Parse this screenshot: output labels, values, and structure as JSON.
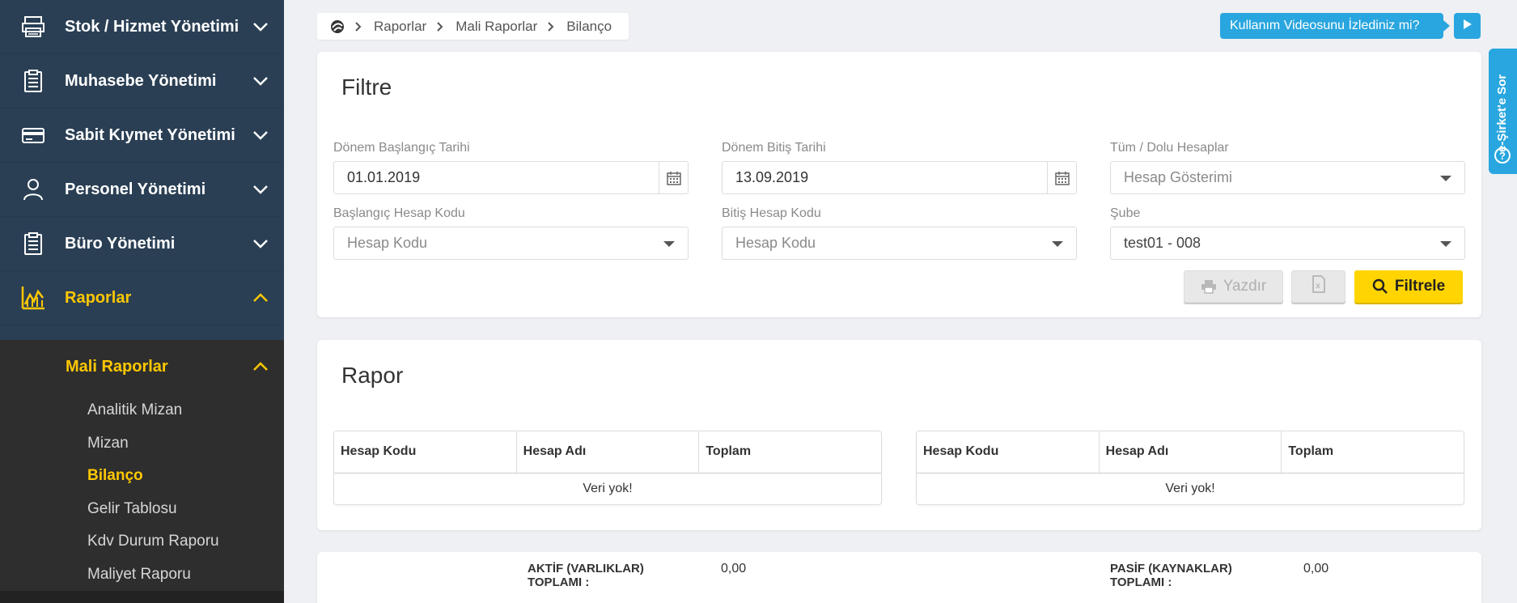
{
  "sidebar": {
    "items": [
      {
        "label": "Stok / Hizmet Yönetimi",
        "icon": "printer-icon"
      },
      {
        "label": "Muhasebe Yönetimi",
        "icon": "clipboard-icon"
      },
      {
        "label": "Sabit Kıymet Yönetimi",
        "icon": "credit-card-icon"
      },
      {
        "label": "Personel Yönetimi",
        "icon": "user-icon"
      },
      {
        "label": "Büro Yönetimi",
        "icon": "clipboard-icon"
      },
      {
        "label": "Raporlar",
        "icon": "chart-icon"
      }
    ],
    "submenu": {
      "title": "Mali Raporlar",
      "items": [
        "Analitik Mizan",
        "Mizan",
        "Bilanço",
        "Gelir Tablosu",
        "Kdv Durum Raporu",
        "Maliyet Raporu"
      ],
      "active": "Bilanço"
    }
  },
  "breadcrumb": [
    "Raporlar",
    "Mali Raporlar",
    "Bilanço"
  ],
  "video_prompt": "Kullanım Videosunu İzlediniz mi?",
  "side_tab": "e-Şirket'e Sor",
  "filter": {
    "title": "Filtre",
    "start_date_label": "Dönem Başlangıç Tarihi",
    "start_date": "01.01.2019",
    "end_date_label": "Dönem Bitiş Tarihi",
    "end_date": "13.09.2019",
    "accounts_label": "Tüm / Dolu Hesaplar",
    "accounts_placeholder": "Hesap Gösterimi",
    "start_code_label": "Başlangıç Hesap Kodu",
    "start_code_placeholder": "Hesap Kodu",
    "end_code_label": "Bitiş Hesap Kodu",
    "end_code_placeholder": "Hesap Kodu",
    "branch_label": "Şube",
    "branch_value": "test01 - 008",
    "print_label": "Yazdır",
    "filter_label": "Filtrele"
  },
  "report": {
    "title": "Rapor",
    "left_table": {
      "headers": [
        "Hesap Kodu",
        "Hesap Adı",
        "Toplam"
      ],
      "empty": "Veri yok!"
    },
    "right_table": {
      "headers": [
        "Hesap Kodu",
        "Hesap Adı",
        "Toplam"
      ],
      "empty": "Veri yok!"
    }
  },
  "totals": {
    "aktif_label_1": "AKTİF (VARLIKLAR)",
    "aktif_label_2": "TOPLAMI :",
    "aktif_value": "0,00",
    "pasif_label_1": "PASİF (KAYNAKLAR)",
    "pasif_label_2": "TOPLAMI :",
    "pasif_value": "0,00"
  },
  "colors": {
    "sidebar": "#2a3f54",
    "accent": "#ffc800",
    "info": "#29a6df",
    "filter_button": "#ffd400"
  }
}
